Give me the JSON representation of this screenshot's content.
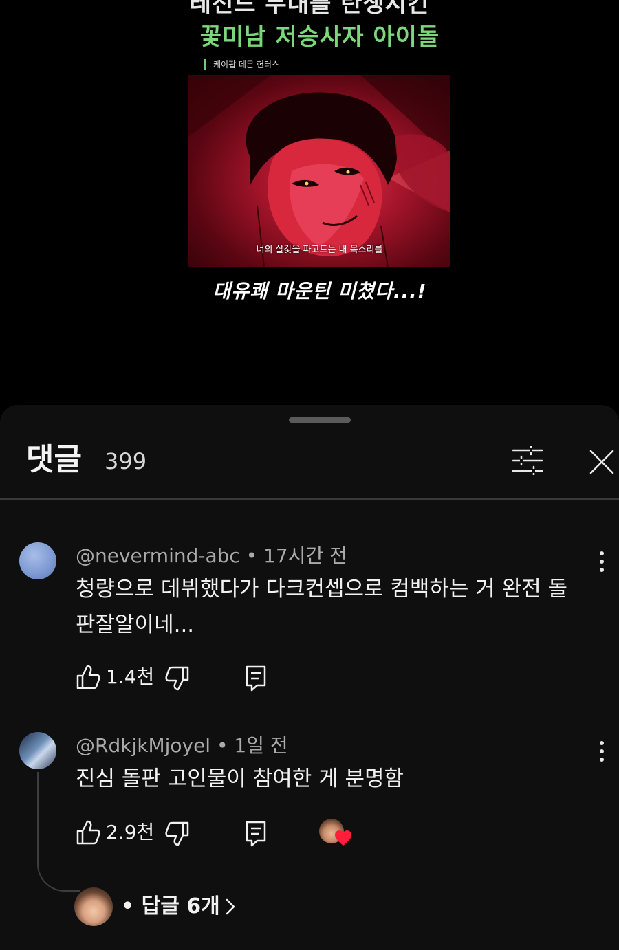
{
  "video": {
    "headline_line1": "레전드 무대를 탄생시킨",
    "headline_line2": "꽃미남 저승사자 아이돌",
    "source_tag": "케이팝 데몬 헌터스",
    "subtitle": "너의 살갗을 파고드는 내 목소리를",
    "caption": "대유쾌 마운틴 미쳤다...!",
    "colors": {
      "headline_green": "#7cd77a",
      "frame_red": "#c01e34"
    }
  },
  "comments_sheet": {
    "title": "댓글",
    "count": "399",
    "icons": {
      "filter": "sliders-icon",
      "close": "close-icon"
    }
  },
  "comments": [
    {
      "author": "@nevermind-abc",
      "time": "17시간 전",
      "meta": "@nevermind-abc • 17시간 전",
      "text": "청량으로 데뷔했다가 다크컨셉으로 컴백하는 거 완전 돌판잘알이네...",
      "likes": "1.4천",
      "avatar_color": "#7f9bd4"
    },
    {
      "author": "@RdkjkMjoyel",
      "time": "1일 전",
      "meta": "@RdkjkMjoyel • 1일 전",
      "text": "진심 돌판 고인물이 참여한 게 분명함",
      "likes": "2.9천",
      "creator_heart": true,
      "replies_label": "• 답글 6개"
    }
  ],
  "theme": {
    "background": "#0f0f0f",
    "text_primary": "#f1f1f1",
    "text_secondary": "#aaaaaa",
    "heart_red": "#ff1f3a"
  }
}
